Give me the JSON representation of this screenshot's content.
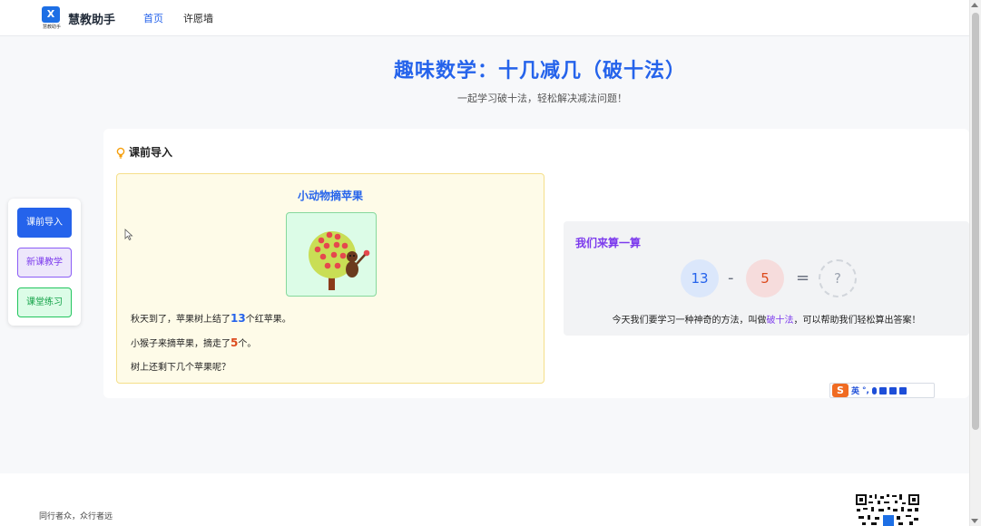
{
  "header": {
    "logo_mark": "X",
    "logo_sub": "慧教助手",
    "brand": "慧教助手",
    "nav": [
      {
        "label": "首页",
        "active": true
      },
      {
        "label": "许愿墙",
        "active": false
      }
    ]
  },
  "hero": {
    "title": "趣味数学：十几减几（破十法）",
    "subtitle": "一起学习破十法，轻松解决减法问题！"
  },
  "section": {
    "title": "课前导入",
    "icon": "lightbulb-icon"
  },
  "story": {
    "title": "小动物摘苹果",
    "line1_before": "秋天到了，苹果树上结了",
    "line1_num": "13",
    "line1_after": "个红苹果。",
    "line2_before": "小猴子来摘苹果，摘走了",
    "line2_num": "5",
    "line2_after": "个。",
    "line3": "树上还剩下几个苹果呢？"
  },
  "calc": {
    "title": "我们来算一算",
    "a": "13",
    "minus": "-",
    "b": "5",
    "equals": "=",
    "answer": "?",
    "desc_before": "今天我们要学习一种神奇的方法，叫做",
    "desc_highlight": "破十法",
    "desc_after": "，可以帮助我们轻松算出答案！"
  },
  "sidenav": {
    "items": [
      {
        "label": "课前导入",
        "active": true
      },
      {
        "label": "新课教学",
        "active": false
      },
      {
        "label": "课堂练习",
        "active": false
      }
    ]
  },
  "ime": {
    "logo": "S",
    "lang": "英"
  },
  "footer": {
    "slogan": "同行者众，众行者远"
  },
  "colors": {
    "primary": "#2563eb",
    "accent_red": "#dc4a1c",
    "purple": "#7c3aed",
    "green": "#16a34a",
    "story_bg": "#fefbe8"
  }
}
